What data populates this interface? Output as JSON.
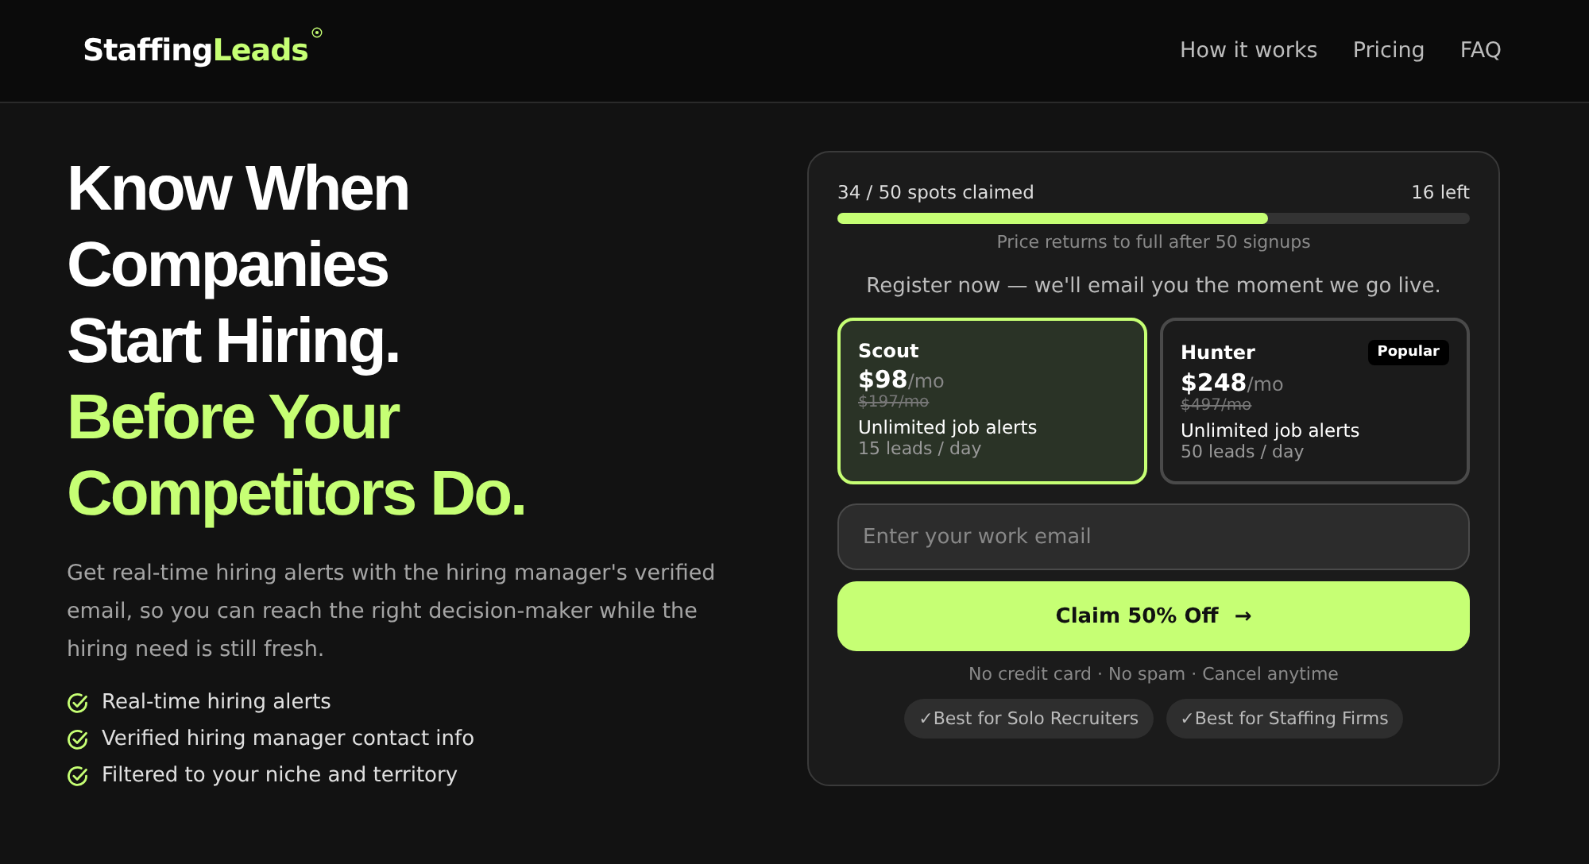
{
  "header": {
    "logo": {
      "text": "Staffing",
      "accent": "Leads"
    },
    "nav": [
      "How it works",
      "Pricing",
      "FAQ"
    ]
  },
  "hero": {
    "headline": [
      {
        "text": "Know When",
        "accent": false
      },
      {
        "text": "Companies",
        "accent": false
      },
      {
        "text": "Start Hiring.",
        "accent": false
      },
      {
        "text": "Before Your",
        "accent": true
      },
      {
        "text": "Competitors Do.",
        "accent": true
      }
    ],
    "description": "Get real-time hiring alerts with the hiring manager's verified email, so you can reach the right decision-maker while the hiring need is still fresh.",
    "features": [
      "Real-time hiring alerts",
      "Verified hiring manager contact info",
      "Filtered to your niche and territory"
    ]
  },
  "signup": {
    "progress": {
      "label": "34 / 50 spots claimed",
      "remaining": "16 left",
      "level": 0.68,
      "note": "Price returns to full after 50 signups"
    },
    "intro": "Register now — we'll email you the moment we go live.",
    "plans": [
      {
        "name": "Scout",
        "price": "$98",
        "period": "/mo",
        "old_price": "$197/mo",
        "feature": "Unlimited job alerts",
        "limit": "15 leads / day",
        "selected": true
      },
      {
        "name": "Hunter",
        "price": "$248",
        "period": "/mo",
        "old_price": "$497/mo",
        "feature": "Unlimited job alerts",
        "limit": "50 leads / day",
        "selected": false,
        "badge": "Popular"
      }
    ],
    "email": {
      "placeholder": "Enter your work email"
    },
    "cta": {
      "label": "Claim 50% Off",
      "arrow": "→"
    },
    "fine_print": "No credit card · No spam · Cancel anytime",
    "tags": [
      "✓Best for Solo Recruiters",
      "✓Best for Staffing Firms"
    ]
  }
}
